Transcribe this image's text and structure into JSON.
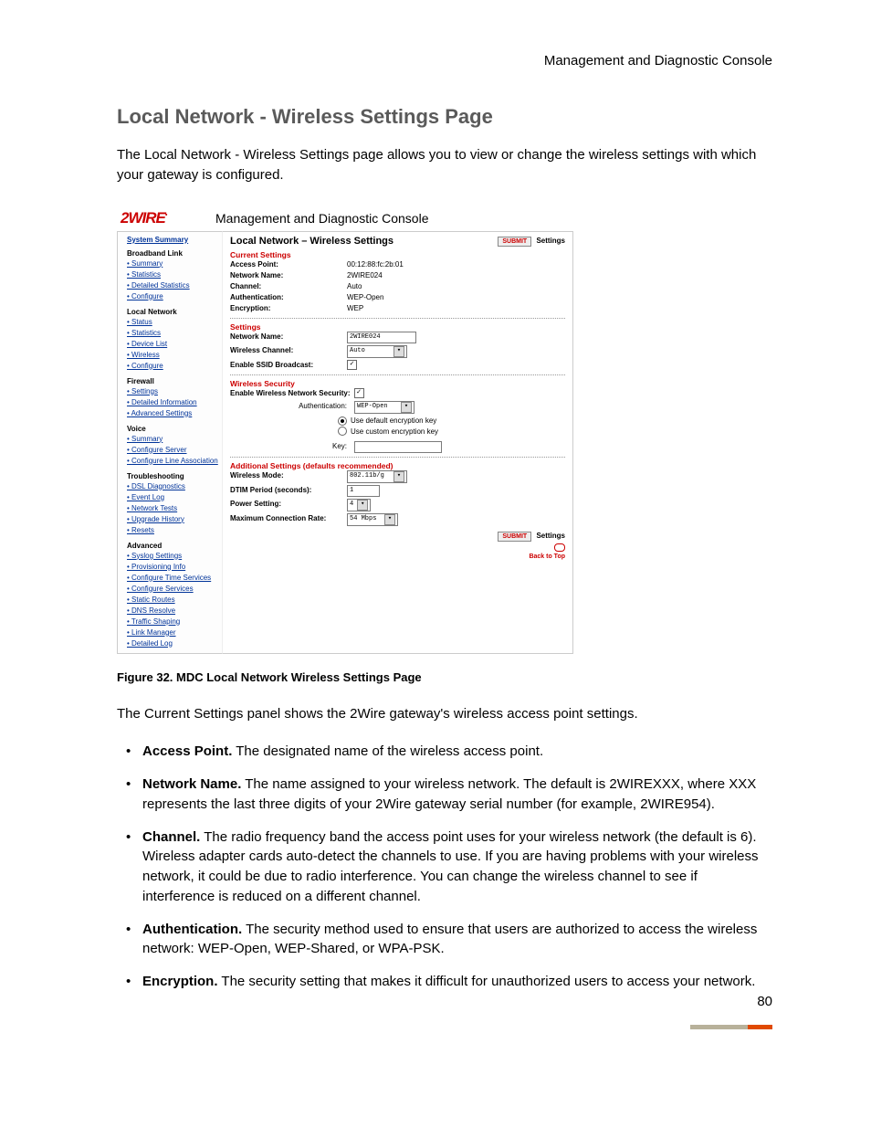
{
  "header_right": "Management and Diagnostic Console",
  "page_title": "Local Network - Wireless Settings Page",
  "intro": "The Local Network - Wireless Settings page allows you to view or change the wireless settings with which your gateway is configured.",
  "figure": {
    "logo": "2WIRE",
    "console_title": "Management and Diagnostic Console",
    "sidebar": {
      "system_summary": "System Summary",
      "groups": [
        {
          "h": "Broadband Link",
          "items": [
            "Summary",
            "Statistics",
            "Detailed Statistics",
            "Configure"
          ]
        },
        {
          "h": "Local Network",
          "items": [
            "Status",
            "Statistics",
            "Device List",
            "Wireless",
            "Configure"
          ]
        },
        {
          "h": "Firewall",
          "items": [
            "Settings",
            "Detailed Information",
            "Advanced Settings"
          ]
        },
        {
          "h": "Voice",
          "items": [
            "Summary",
            "Configure Server",
            "Configure Line Association"
          ]
        },
        {
          "h": "Troubleshooting",
          "items": [
            "DSL Diagnostics",
            "Event Log",
            "Network Tests",
            "Upgrade History",
            "Resets"
          ]
        },
        {
          "h": "Advanced",
          "items": [
            "Syslog Settings",
            "Provisioning Info",
            "Configure Time Services",
            "Configure Services",
            "Static Routes",
            "DNS Resolve",
            "Traffic Shaping",
            "Link Manager",
            "Detailed Log"
          ]
        }
      ]
    },
    "main": {
      "title": "Local Network – Wireless Settings",
      "submit": "SUBMIT",
      "settings_label": "Settings",
      "current": {
        "h": "Current Settings",
        "access_point_l": "Access Point:",
        "access_point_v": "00:12:88:fc:2b:01",
        "network_name_l": "Network Name:",
        "network_name_v": "2WIRE024",
        "channel_l": "Channel:",
        "channel_v": "Auto",
        "auth_l": "Authentication:",
        "auth_v": "WEP-Open",
        "enc_l": "Encryption:",
        "enc_v": "WEP"
      },
      "settings": {
        "h": "Settings",
        "network_name_l": "Network Name:",
        "network_name_v": "2WIRE024",
        "channel_l": "Wireless Channel:",
        "channel_v": "Auto",
        "ssid_l": "Enable SSID Broadcast:",
        "ssid_checked": "✓"
      },
      "security": {
        "h": "Wireless Security",
        "enable_l": "Enable Wireless Network Security:",
        "enable_checked": "✓",
        "auth_l": "Authentication:",
        "auth_v": "WEP-Open",
        "r1": "Use default encryption key",
        "r2": "Use custom encryption key",
        "key_l": "Key:"
      },
      "additional": {
        "h": "Additional Settings (defaults recommended)",
        "mode_l": "Wireless Mode:",
        "mode_v": "802.11b/g",
        "dtim_l": "DTIM Period (seconds):",
        "dtim_v": "1",
        "power_l": "Power Setting:",
        "power_v": "4",
        "rate_l": "Maximum Connection Rate:",
        "rate_v": "54 Mbps"
      },
      "back_to_top": "Back to Top"
    }
  },
  "fig_caption": "Figure 32. MDC Local Network Wireless Settings Page",
  "panel_intro": "The Current Settings panel shows the 2Wire gateway's wireless access point settings.",
  "bullets": [
    {
      "b": "Access Point.",
      "t": " The designated name of the wireless access point."
    },
    {
      "b": "Network Name.",
      "t": " The name assigned to your wireless network. The default is 2WIREXXX, where XXX represents the last three digits of your 2Wire gateway serial number (for example, 2WIRE954)."
    },
    {
      "b": "Channel.",
      "t": " The radio frequency band the access point uses for your wireless network (the default is 6). Wireless adapter cards auto-detect the channels to use. If you are having problems with your wireless network, it could be due to radio interference. You can change the wireless channel to see if interference is reduced on a different channel."
    },
    {
      "b": "Authentication.",
      "t": " The security method used to ensure that users are authorized to access the wireless network: WEP-Open, WEP-Shared, or WPA-PSK."
    },
    {
      "b": "Encryption.",
      "t": " The security setting that makes it difficult for unauthorized users to access your network."
    }
  ],
  "page_num": "80"
}
